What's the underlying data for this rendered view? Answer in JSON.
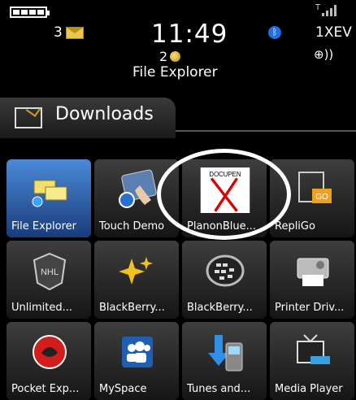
{
  "status": {
    "mail_count": "3",
    "time": "11:49",
    "bbm_count": "2",
    "network": "1XEV",
    "app_title": "File Explorer"
  },
  "folder": {
    "title": "Downloads"
  },
  "apps": [
    {
      "label": "File Explorer",
      "icon": "file-explorer-icon"
    },
    {
      "label": "Touch Demo",
      "icon": "touch-demo-icon"
    },
    {
      "label": "PlanonBlue...",
      "icon": "docupen-icon",
      "icon_text": "DOCUPEN"
    },
    {
      "label": "RepliGo",
      "icon": "repligo-icon",
      "icon_text": "GO"
    },
    {
      "label": "Unlimited...",
      "icon": "nhl-icon",
      "icon_text": "NHL"
    },
    {
      "label": "BlackBerry...",
      "icon": "sparkle-icon"
    },
    {
      "label": "BlackBerry...",
      "icon": "blackberry-logo-icon"
    },
    {
      "label": "Printer Driv...",
      "icon": "printer-icon"
    },
    {
      "label": "Pocket Exp...",
      "icon": "pocket-express-icon"
    },
    {
      "label": "MySpace",
      "icon": "myspace-icon"
    },
    {
      "label": "Tunes and...",
      "icon": "tunes-icon"
    },
    {
      "label": "Media Player",
      "icon": "media-player-icon"
    }
  ],
  "colors": {
    "selected": "#2f6ac0",
    "background": "#000000"
  }
}
